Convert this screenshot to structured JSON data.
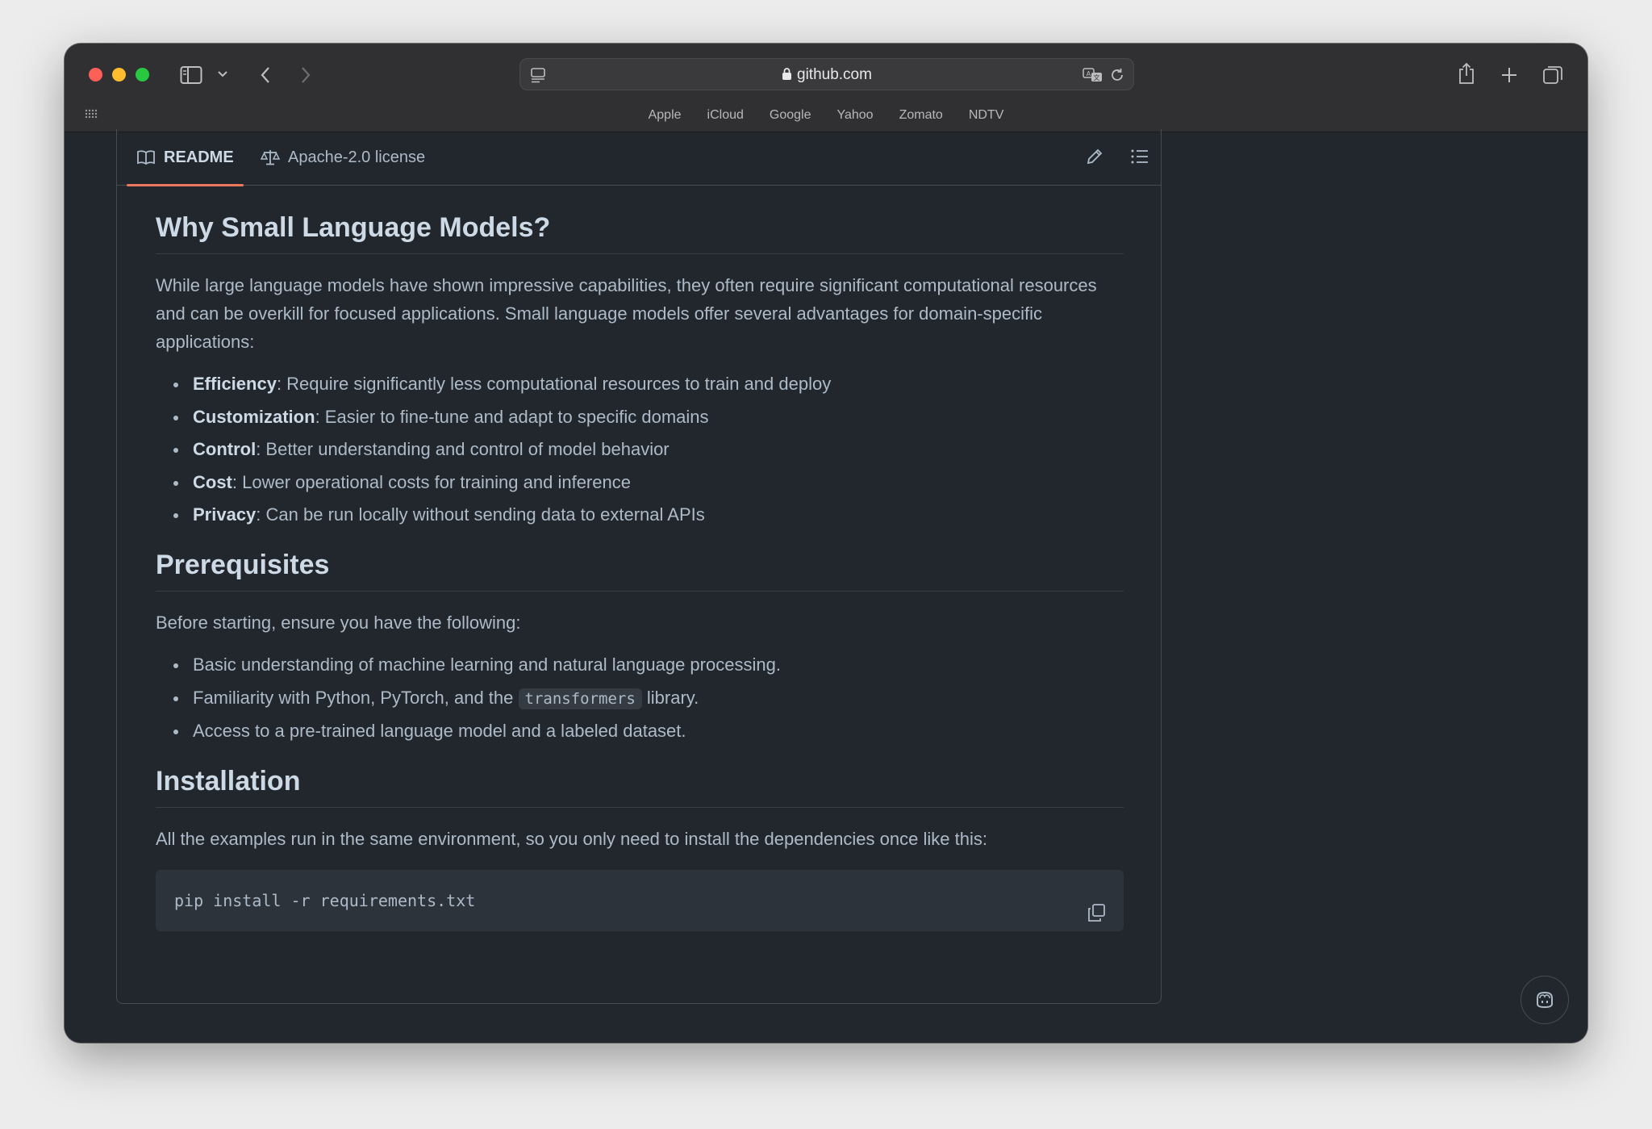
{
  "browser": {
    "url": "github.com",
    "favorites": [
      "Apple",
      "iCloud",
      "Google",
      "Yahoo",
      "Zomato",
      "NDTV"
    ]
  },
  "tabs": {
    "readme": "README",
    "license": "Apache-2.0 license"
  },
  "sections": {
    "why": {
      "heading": "Why Small Language Models?",
      "intro": "While large language models have shown impressive capabilities, they often require significant computational resources and can be overkill for focused applications. Small language models offer several advantages for domain-specific applications:",
      "items": [
        {
          "term": "Efficiency",
          "text": ": Require significantly less computational resources to train and deploy"
        },
        {
          "term": "Customization",
          "text": ": Easier to fine-tune and adapt to specific domains"
        },
        {
          "term": "Control",
          "text": ": Better understanding and control of model behavior"
        },
        {
          "term": "Cost",
          "text": ": Lower operational costs for training and inference"
        },
        {
          "term": "Privacy",
          "text": ": Can be run locally without sending data to external APIs"
        }
      ]
    },
    "prereq": {
      "heading": "Prerequisites",
      "intro": "Before starting, ensure you have the following:",
      "item1": "Basic understanding of machine learning and natural language processing.",
      "item2_before": "Familiarity with Python, PyTorch, and the ",
      "item2_code": "transformers",
      "item2_after": " library.",
      "item3": "Access to a pre-trained language model and a labeled dataset."
    },
    "install": {
      "heading": "Installation",
      "intro": "All the examples run in the same environment, so you only need to install the dependencies once like this:",
      "command": "pip install -r requirements.txt"
    }
  },
  "icons": {
    "sidebar": "sidebar-icon",
    "back": "chevron-left-icon",
    "forward": "chevron-right-icon",
    "share": "share-icon",
    "new_tab": "plus-icon",
    "tabs": "tab-overview-icon",
    "edit": "pencil-icon",
    "outline": "list-icon",
    "copy": "copy-icon",
    "copilot": "copilot-icon"
  },
  "colors": {
    "accent_underline": "#ec775c",
    "background": "#22272e"
  }
}
